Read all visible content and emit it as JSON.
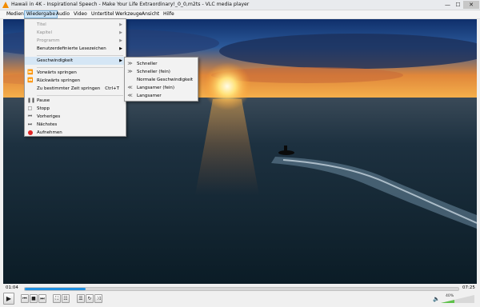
{
  "window": {
    "title": "Hawaii in 4K - Inspirational Speech - Make Your Life Extraordinary!_0_0,m2ts - VLC media player",
    "minimize_glyph": "—",
    "maximize_glyph": "☐",
    "close_glyph": "✕"
  },
  "menubar": {
    "items": [
      "Medien",
      "Wiedergabe",
      "Audio",
      "Video",
      "Untertitel",
      "Werkzeuge",
      "Ansicht",
      "Hilfe"
    ],
    "active": "Wiedergabe"
  },
  "playback_menu": {
    "items": [
      {
        "label": "Titel",
        "disabled": true,
        "submenu": true
      },
      {
        "label": "Kapitel",
        "disabled": true,
        "submenu": true
      },
      {
        "label": "Programm",
        "disabled": true,
        "submenu": true
      },
      {
        "label": "Benutzerdefinierte Lesezeichen",
        "disabled": false,
        "submenu": true
      },
      {
        "label": "Geschwindigkeit",
        "disabled": false,
        "submenu": true,
        "highlighted": true
      },
      {
        "label": "Vorwärts springen",
        "icon": "skip-forward-icon"
      },
      {
        "label": "Rückwärts springen",
        "icon": "skip-backward-icon"
      },
      {
        "label": "Zu bestimmter Zeit springen",
        "shortcut": "Ctrl+T"
      },
      {
        "label": "Pause",
        "icon": "pause-icon"
      },
      {
        "label": "Stopp",
        "icon": "stop-icon"
      },
      {
        "label": "Vorheriges",
        "icon": "previous-icon"
      },
      {
        "label": "Nächstes",
        "icon": "next-icon"
      },
      {
        "label": "Aufnehmen",
        "icon": "record-icon"
      }
    ]
  },
  "speed_menu": {
    "items": [
      {
        "label": "Schneller",
        "icon": "faster-icon"
      },
      {
        "label": "Schneller (fein)",
        "icon": "faster-fine-icon"
      },
      {
        "label": "Normale Geschwindigkeit",
        "icon": ""
      },
      {
        "label": "Langsamer (fein)",
        "icon": "slower-fine-icon"
      },
      {
        "label": "Langsamer",
        "icon": "slower-icon"
      }
    ]
  },
  "timeline": {
    "current_time": "01:04",
    "total_time": "07:25",
    "progress": 0.14
  },
  "controls": {
    "play_glyph": "▶",
    "prev_glyph": "⏮",
    "stop_glyph": "■",
    "next_glyph": "⏭",
    "fullscreen_glyph": "⛶",
    "extended_glyph": "☷",
    "playlist_glyph": "☰",
    "loop_glyph": "↻",
    "shuffle_glyph": "⤨",
    "volume_glyph": "🔈",
    "volume_percent": "40%",
    "volume_level": 0.4
  },
  "colors": {
    "seek_fill": "#1e8fe0",
    "volume_fill": "#5ec14a",
    "menu_highlight": "#d5e6f5"
  }
}
